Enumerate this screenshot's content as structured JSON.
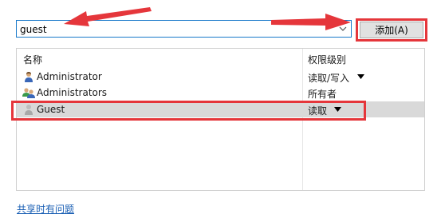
{
  "search": {
    "value": "guest"
  },
  "add_button": {
    "label": "添加(A)"
  },
  "list": {
    "headers": {
      "name": "名称",
      "permission": "权限级别"
    },
    "rows": [
      {
        "name": "Administrator",
        "permission": "读取/写入",
        "icon": "user-icon",
        "has_dropdown": true,
        "selected": false
      },
      {
        "name": "Administrators",
        "permission": "所有者",
        "icon": "group-icon",
        "has_dropdown": false,
        "selected": false
      },
      {
        "name": "Guest",
        "permission": "读取",
        "icon": "guest-user-icon",
        "has_dropdown": true,
        "selected": true
      }
    ]
  },
  "help_link": {
    "label": "共享时有问题"
  },
  "annotations": {
    "color": "#e5363b",
    "arrows": [
      "arrow-to-search-input",
      "arrow-to-add-button"
    ],
    "boxes": [
      "add-button",
      "guest-row"
    ]
  },
  "colors": {
    "accent": "#1979ca",
    "selection": "#d9d9d9",
    "link": "#1a5fb4"
  }
}
